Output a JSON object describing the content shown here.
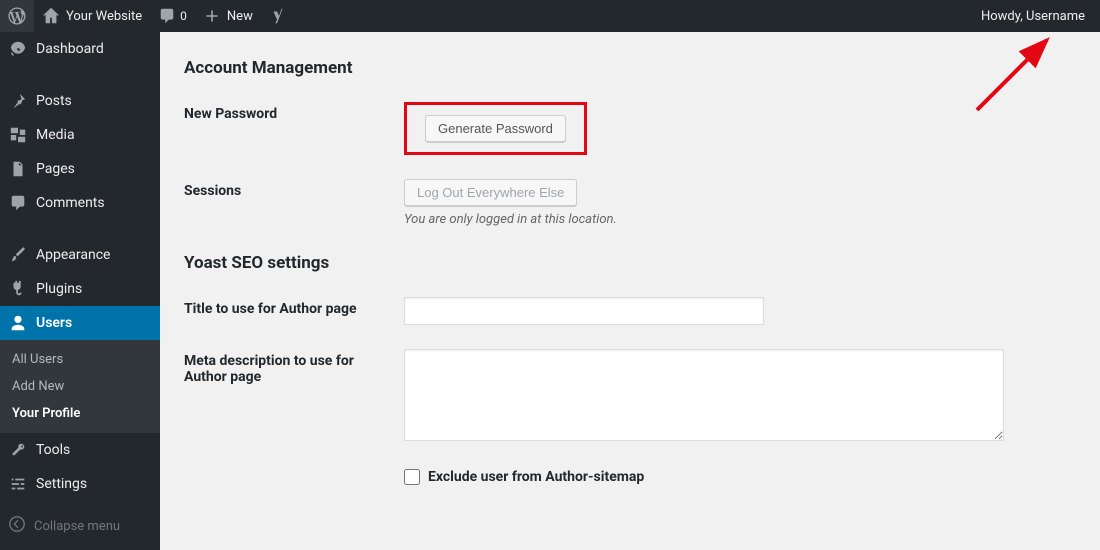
{
  "adminbar": {
    "site_name": "Your Website",
    "comments_count": "0",
    "new_label": "New",
    "howdy": "Howdy, Username"
  },
  "sidebar": {
    "dashboard": "Dashboard",
    "posts": "Posts",
    "media": "Media",
    "pages": "Pages",
    "comments": "Comments",
    "appearance": "Appearance",
    "plugins": "Plugins",
    "users": "Users",
    "tools": "Tools",
    "settings": "Settings",
    "collapse": "Collapse menu",
    "users_sub": {
      "all": "All Users",
      "add": "Add New",
      "profile": "Your Profile"
    }
  },
  "sections": {
    "account": "Account Management",
    "yoast": "Yoast SEO settings"
  },
  "fields": {
    "new_password_label": "New Password",
    "generate_password_btn": "Generate Password",
    "sessions_label": "Sessions",
    "logout_everywhere_btn": "Log Out Everywhere Else",
    "sessions_description": "You are only logged in at this location.",
    "author_title_label": "Title to use for Author page",
    "author_title_value": "",
    "author_meta_label": "Meta description to use for Author page",
    "author_meta_value": "",
    "exclude_sitemap_label": "Exclude user from Author-sitemap",
    "exclude_sitemap_checked": false
  }
}
